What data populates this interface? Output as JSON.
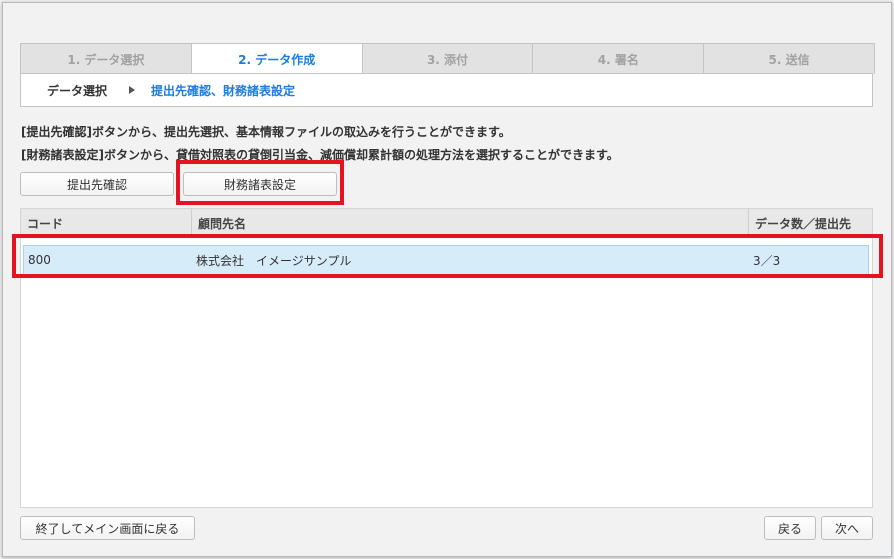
{
  "tabs": [
    "1. データ選択",
    "2. データ作成",
    "3. 添付",
    "4. 署名",
    "5. 送信"
  ],
  "breadcrumb": {
    "previous": "データ選択",
    "current": "提出先確認、財務諸表設定"
  },
  "descriptions": [
    "[提出先確認]ボタンから、提出先選択、基本情報ファイルの取込みを行うことができます。",
    "[財務諸表設定]ボタンから、貸借対照表の貸倒引当金、減価償却累計額の処理方法を選択することができます。"
  ],
  "buttons": {
    "confirm_destination": "提出先確認",
    "financial_settings": "財務諸表設定",
    "exit": "終了してメイン画面に戻る",
    "back": "戻る",
    "next": "次へ"
  },
  "table": {
    "headers": [
      "コード",
      "顧問先名",
      "データ数／提出先"
    ],
    "rows": [
      [
        "800",
        "株式会社　イメージサンプル",
        "3／3"
      ]
    ]
  },
  "colors": {
    "accent": "#1a7ee0",
    "highlight": "#e3141f",
    "selected_row": "#d6ecf9"
  }
}
